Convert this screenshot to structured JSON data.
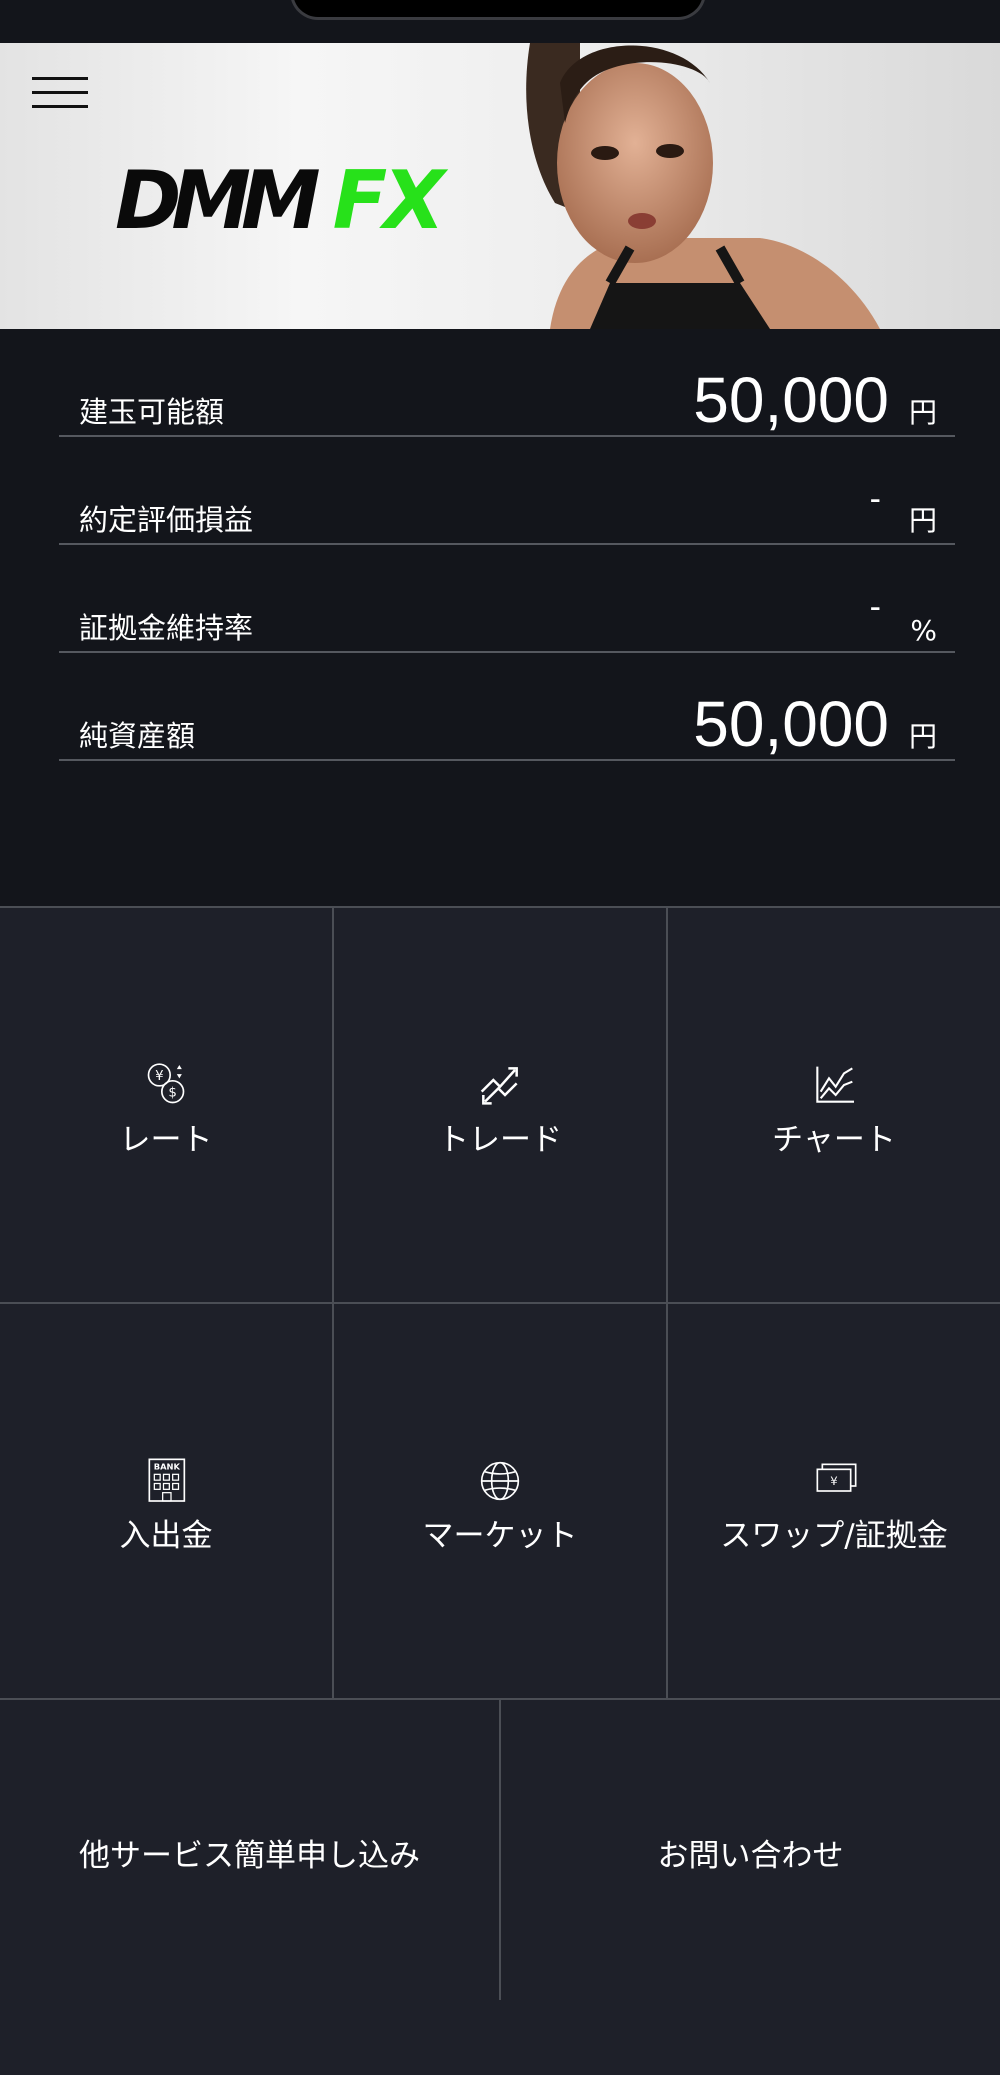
{
  "banner": {
    "logo_dmm": "DMM",
    "logo_fx": "FX"
  },
  "summary": {
    "rows": [
      {
        "label": "建玉可能額",
        "value": "50,000",
        "unit": "円"
      },
      {
        "label": "約定評価損益",
        "value": "-",
        "unit": "円"
      },
      {
        "label": "証拠金維持率",
        "value": "-",
        "unit": "%"
      },
      {
        "label": "純資産額",
        "value": "50,000",
        "unit": "円"
      }
    ]
  },
  "menu": {
    "rate": {
      "label": "レート",
      "icon": "currency-exchange-icon"
    },
    "trade": {
      "label": "トレード",
      "icon": "trade-arrows-icon"
    },
    "chart": {
      "label": "チャート",
      "icon": "line-chart-icon"
    },
    "deposit": {
      "label": "入出金",
      "icon": "bank-icon",
      "icon_text": "BANK"
    },
    "market": {
      "label": "マーケット",
      "icon": "globe-icon"
    },
    "swap": {
      "label": "スワップ/証拠金",
      "icon": "yen-bills-icon",
      "icon_text": "¥"
    },
    "other_services": {
      "label": "他サービス簡単申し込み"
    },
    "contact": {
      "label": "お問い合わせ"
    }
  },
  "colors": {
    "accent_green": "#27e11a",
    "background": "#13151b",
    "tile": "#1e2029"
  }
}
